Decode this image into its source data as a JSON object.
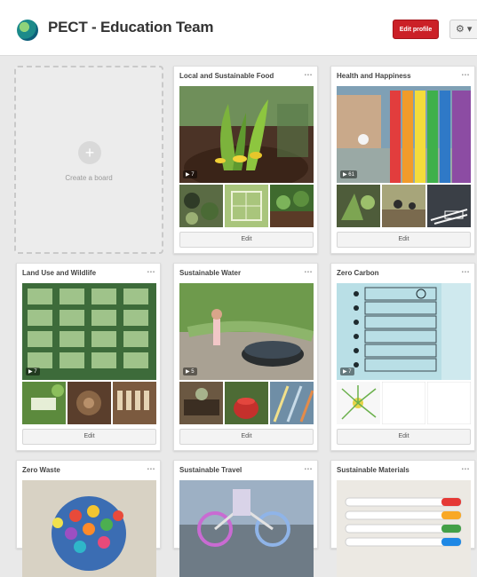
{
  "header": {
    "title": "PECT - Education Team",
    "edit_profile_label": "Edit profile",
    "settings_label": "⚙ ▾"
  },
  "create_board": {
    "label": "Create a board",
    "plus": "+"
  },
  "boards": [
    {
      "title": "Local and Sustainable Food",
      "count": "▪▪▪",
      "edit_label": "Edit",
      "badge": "▶ 7"
    },
    {
      "title": "Health and Happiness",
      "count": "▪▪▪",
      "edit_label": "Edit",
      "badge": "▶ 61"
    },
    {
      "title": "Land Use and Wildlife",
      "count": "▪▪▪",
      "edit_label": "Edit",
      "badge": "▶ 7"
    },
    {
      "title": "Sustainable Water",
      "count": "▪▪▪",
      "edit_label": "Edit",
      "badge": "▶ 5"
    },
    {
      "title": "Zero Carbon",
      "count": "▪▪▪",
      "edit_label": "Edit",
      "badge": "▶ 7"
    },
    {
      "title": "Zero Waste",
      "count": "▪▪▪"
    },
    {
      "title": "Sustainable Travel",
      "count": "▪▪▪"
    },
    {
      "title": "Sustainable Materials",
      "count": "▪▪▪"
    }
  ],
  "colors": {
    "brand_red": "#cb2027",
    "background": "#e9e9e9"
  }
}
